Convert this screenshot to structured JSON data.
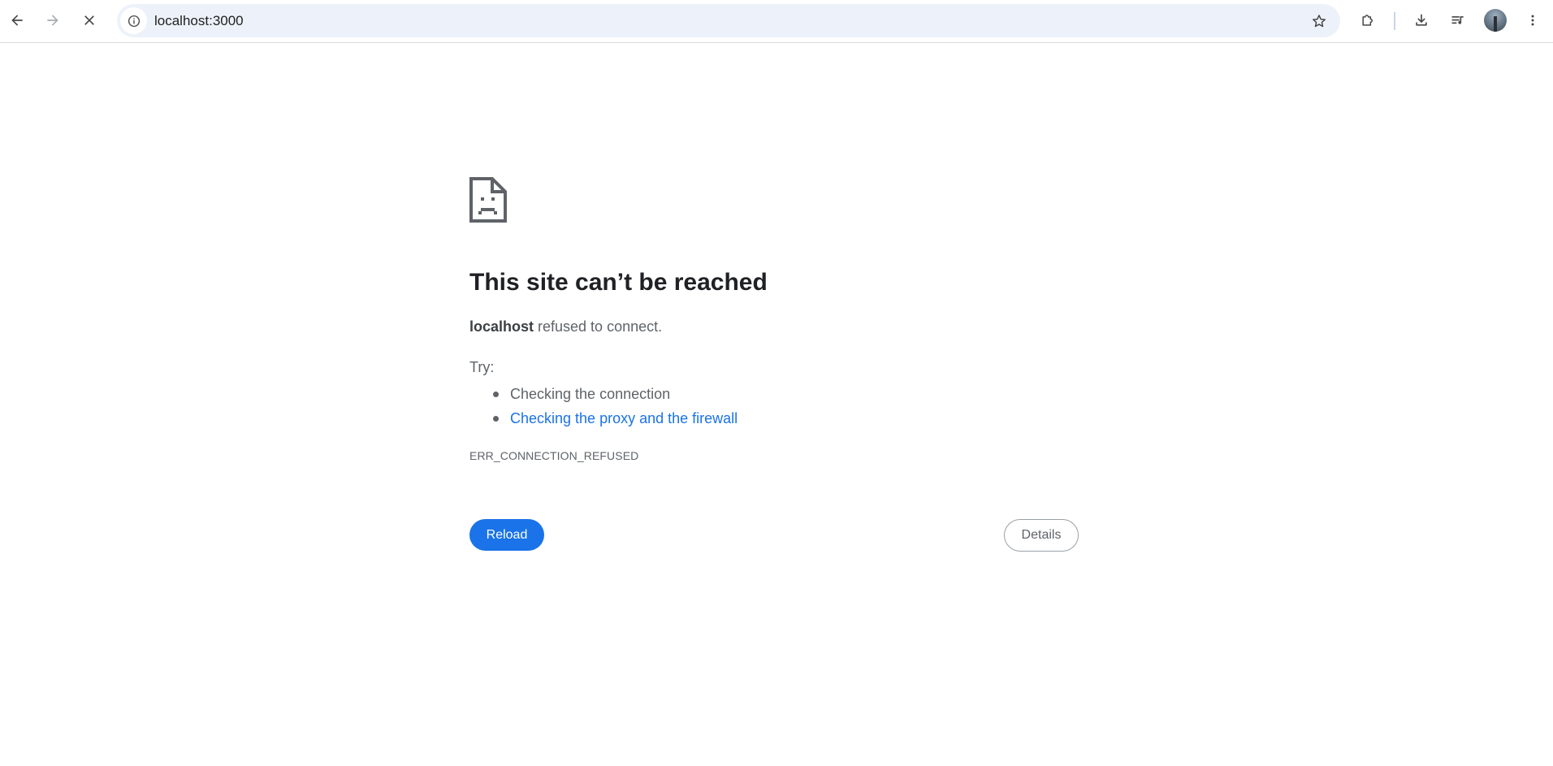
{
  "browser": {
    "address_bar": {
      "url": "localhost:3000"
    },
    "icons": {
      "back": "back-arrow-icon",
      "forward": "forward-arrow-icon",
      "stop": "stop-loading-icon",
      "site_info": "info-icon",
      "bookmark": "star-icon",
      "extensions": "puzzle-icon",
      "downloads": "download-icon",
      "reading_list": "media-control-icon",
      "profile": "avatar",
      "menu": "kebab-menu-icon"
    }
  },
  "error_page": {
    "icon": "sad-page-icon",
    "title": "This site can’t be reached",
    "host": "localhost",
    "description_suffix": " refused to connect.",
    "try_label": "Try:",
    "suggestions": [
      {
        "label": "Checking the connection",
        "is_link": false
      },
      {
        "label": "Checking the proxy and the firewall",
        "is_link": true
      }
    ],
    "error_code": "ERR_CONNECTION_REFUSED",
    "reload_label": "Reload",
    "details_label": "Details",
    "colors": {
      "primary_button": "#1a73e8",
      "link": "#1a73e8",
      "secondary_text": "#5f6368"
    }
  }
}
